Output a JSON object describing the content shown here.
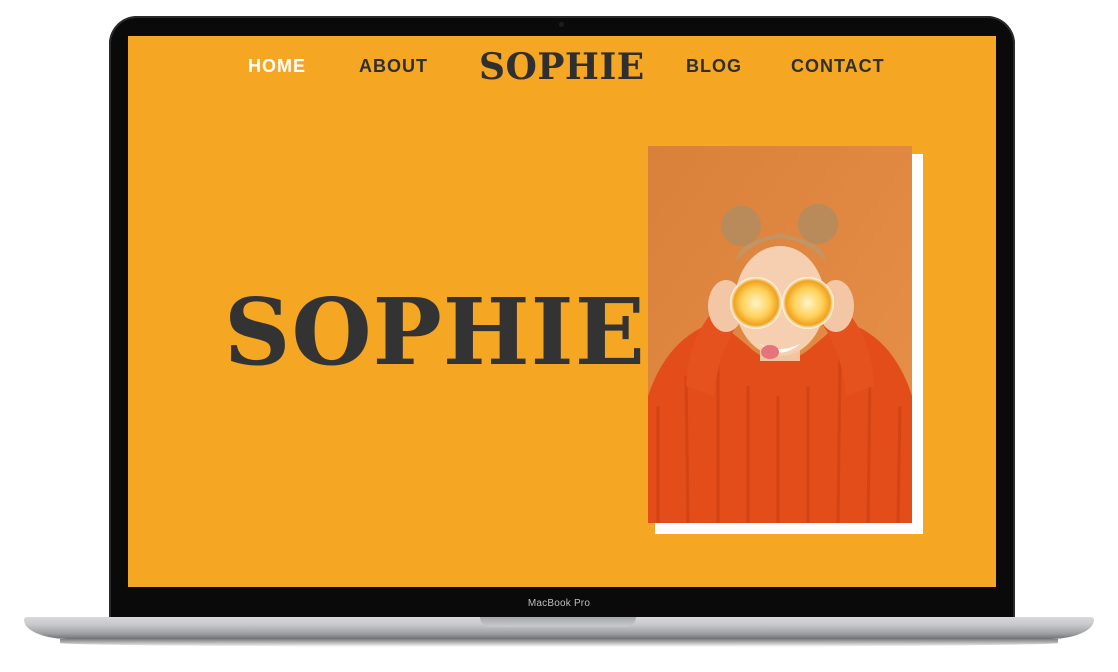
{
  "device": {
    "label": "MacBook Pro"
  },
  "site": {
    "nav": {
      "home": "HOME",
      "about": "ABOUT",
      "brand": "SOPHIE",
      "blog": "BLOG",
      "contact": "CONTACT"
    },
    "hero": {
      "title": "SOPHIE"
    },
    "colors": {
      "background": "#f5a623",
      "text_dark": "#2f2f2f",
      "nav_active": "#ffffff",
      "photo_frame": "#ffffff"
    },
    "photo": {
      "icon": "portrait-photo"
    }
  }
}
